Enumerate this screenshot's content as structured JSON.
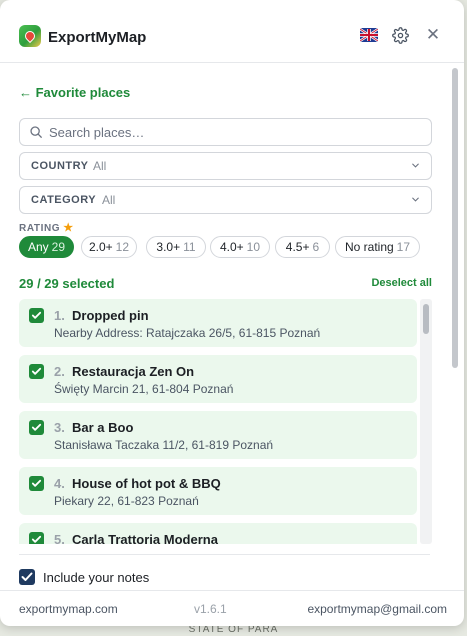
{
  "app": {
    "title": "ExportMyMap",
    "language_flag": "uk-flag-icon"
  },
  "nav": {
    "back_label": "← Favorite places"
  },
  "search": {
    "placeholder": "Search places…",
    "value": ""
  },
  "filters": {
    "country": {
      "label": "COUNTRY",
      "value": "All"
    },
    "category": {
      "label": "CATEGORY",
      "value": "All"
    },
    "rating": {
      "label": "RATING",
      "chips": [
        {
          "label": "Any",
          "count": "29",
          "active": true
        },
        {
          "label": "2.0+",
          "count": "12",
          "active": false
        },
        {
          "label": "3.0+",
          "count": "11",
          "active": false
        },
        {
          "label": "4.0+",
          "count": "10",
          "active": false
        },
        {
          "label": "4.5+",
          "count": "6",
          "active": false
        },
        {
          "label": "No rating",
          "count": "17",
          "active": false
        }
      ]
    }
  },
  "selection": {
    "summary": "29 / 29 selected",
    "deselect_label": "Deselect all"
  },
  "places": [
    {
      "num": "1.",
      "name": "Dropped pin",
      "address": "Nearby Address: Ratajczaka 26/5, 61-815 Poznań",
      "checked": true
    },
    {
      "num": "2.",
      "name": "Restauracja Zen On",
      "address": "Święty Marcin 21, 61-804 Poznań",
      "checked": true
    },
    {
      "num": "3.",
      "name": "Bar a Boo",
      "address": "Stanisława Taczaka 11/2, 61-819 Poznań",
      "checked": true
    },
    {
      "num": "4.",
      "name": "House of hot pot & BBQ",
      "address": "Piekary 22, 61-823 Poznań",
      "checked": true
    },
    {
      "num": "5.",
      "name": "Carla Trattoria Moderna",
      "address": "",
      "checked": true
    }
  ],
  "options": {
    "include_notes_label": "Include your notes",
    "include_notes_checked": true
  },
  "footer": {
    "website": "exportmymap.com",
    "version": "v1.6.1",
    "email": "exportmymap@gmail.com"
  },
  "map": {
    "bottom_label": "STATE OF PARA"
  },
  "colors": {
    "accent": "#1f8a3a",
    "selected_row": "#ebf8ed"
  }
}
